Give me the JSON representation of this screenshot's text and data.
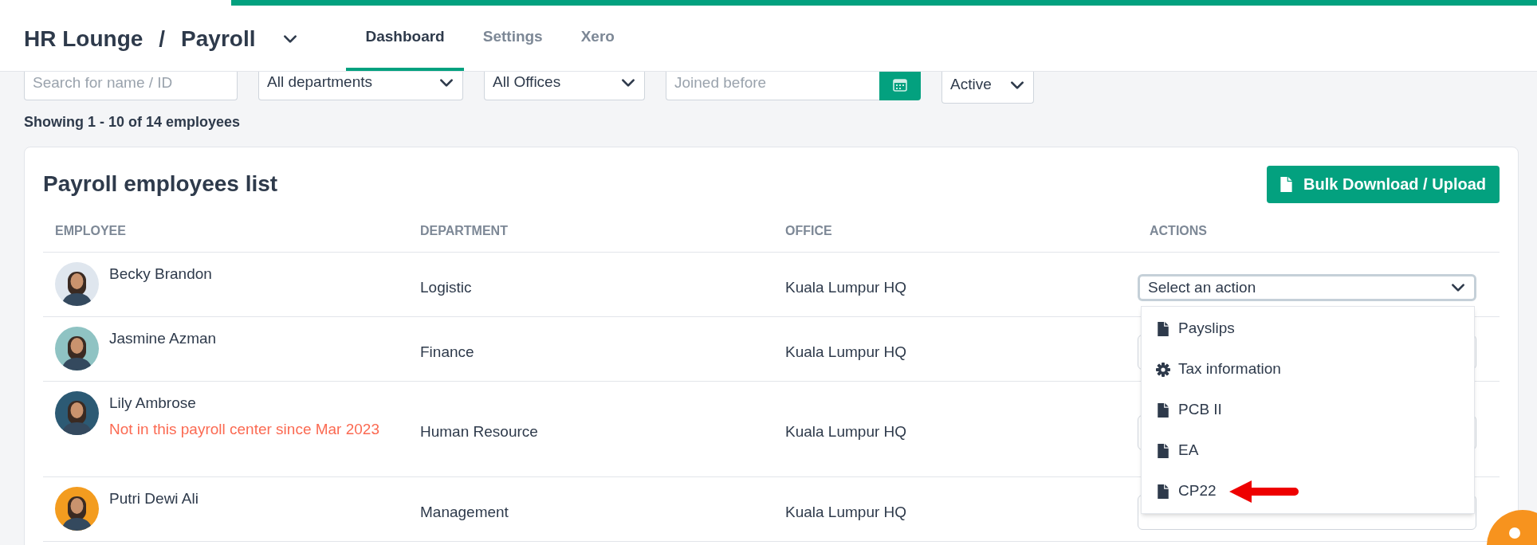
{
  "header": {
    "breadcrumb": [
      "HR Lounge",
      "/",
      "Payroll"
    ],
    "tabs": [
      {
        "label": "Dashboard",
        "selected": true
      },
      {
        "label": "Settings",
        "selected": false
      },
      {
        "label": "Xero",
        "selected": false
      }
    ]
  },
  "filters": {
    "search": {
      "placeholder": "Search for name / ID"
    },
    "department": {
      "value": "All departments"
    },
    "office": {
      "value": "All Offices"
    },
    "joined": {
      "placeholder": "Joined before"
    },
    "status": {
      "value": "Active"
    }
  },
  "summary": "Showing 1 - 10 of 14 employees",
  "card": {
    "title": "Payroll employees list",
    "button": "Bulk Download / Upload",
    "table": {
      "columns": [
        "EMPLOYEE",
        "DEPARTMENT",
        "OFFICE",
        "ACTIONS"
      ],
      "rows": [
        {
          "name": "Becky Brandon",
          "department": "Logistic",
          "office": "Kuala Lumpur HQ",
          "action": {
            "placeholder": "Select an action",
            "expanded": true
          }
        },
        {
          "name": "Jasmine Azman",
          "department": "Finance",
          "office": "Kuala Lumpur HQ",
          "action": {
            "expanded": false
          }
        },
        {
          "name": "Lily Ambrose",
          "note": "Not in this payroll center since Mar 2023",
          "department": "Human Resource",
          "office": "Kuala Lumpur HQ",
          "action": {
            "expanded": false
          }
        },
        {
          "name": "Putri Dewi Ali",
          "department": "Management",
          "office": "Kuala Lumpur HQ",
          "action": {
            "expanded": false
          }
        }
      ]
    },
    "menu": [
      {
        "label": "Payslips",
        "kind": "document",
        "pointer": false
      },
      {
        "label": "Tax information",
        "kind": "settings",
        "pointer": false
      },
      {
        "label": "PCB II",
        "kind": "document",
        "pointer": false
      },
      {
        "label": "EA",
        "kind": "document",
        "pointer": false
      },
      {
        "label": "CP22",
        "kind": "document",
        "pointer": true
      }
    ]
  }
}
